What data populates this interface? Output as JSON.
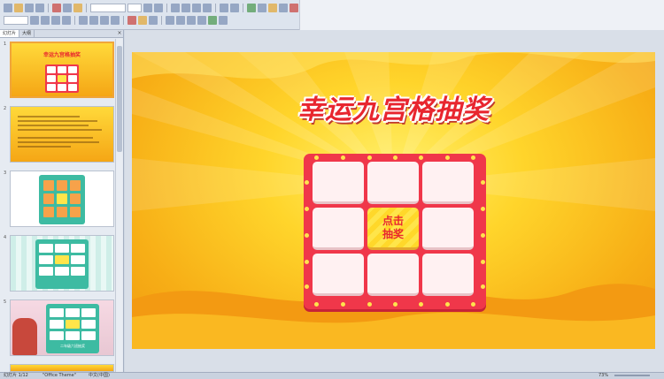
{
  "app": {
    "panel_tabs": [
      "幻灯片",
      "大纲"
    ],
    "panel_close": "×"
  },
  "slides": [
    {
      "number": "1",
      "title": "幸运九宫格抽奖",
      "selected": true
    },
    {
      "number": "2"
    },
    {
      "number": "3"
    },
    {
      "number": "4"
    },
    {
      "number": "5",
      "caption": "二年级六班抽奖"
    }
  ],
  "main_slide": {
    "title": "幸运九宫格抽奖",
    "center_button": "点击\n抽奖",
    "center_button_line1": "点击",
    "center_button_line2": "抽奖",
    "colors": {
      "board": "#f0374a",
      "title": "#e8262f",
      "center_cell": "#ffe54a",
      "cell": "#fff1f2"
    }
  },
  "status": {
    "slide_info": "幻灯片 1/12",
    "theme": "\"Office Theme\"",
    "language": "中文(中国)",
    "zoom": "73%"
  }
}
